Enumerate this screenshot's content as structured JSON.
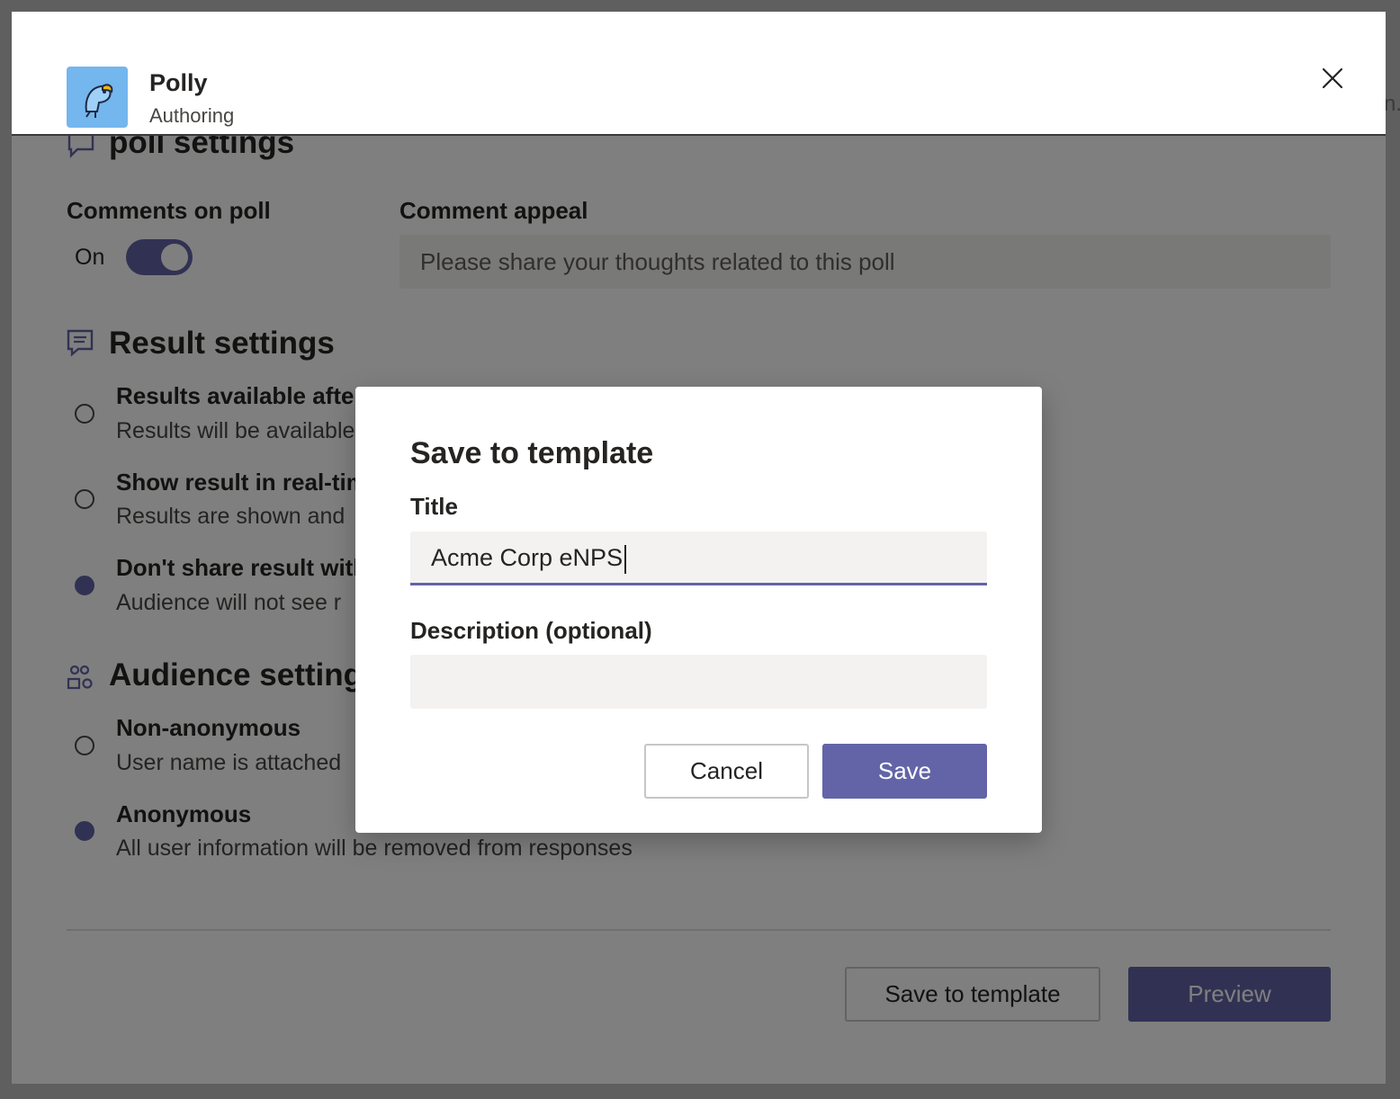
{
  "header": {
    "app_name": "Polly",
    "subtitle": "Authoring",
    "logo_icon": "parrot-icon",
    "close_icon": "close-icon"
  },
  "background_edge": {
    "right_fragment": "n."
  },
  "poll_settings": {
    "heading": "poll settings",
    "comments_label": "Comments on poll",
    "comments_toggle_state": "On",
    "comments_enabled": true,
    "appeal_label": "Comment appeal",
    "appeal_placeholder": "Please share your thoughts related to this poll"
  },
  "result_settings": {
    "heading": "Result settings",
    "options": [
      {
        "title": "Results available after poll closes",
        "desc": "Results will be available",
        "selected": false
      },
      {
        "title": "Show result in real-time",
        "desc": "Results are shown and",
        "selected": false
      },
      {
        "title": "Don't share result with",
        "desc": "Audience will not see r",
        "selected": true
      }
    ]
  },
  "audience_settings": {
    "heading": "Audience settings",
    "options": [
      {
        "title": "Non-anonymous",
        "desc": "User name is attached",
        "selected": false
      },
      {
        "title": "Anonymous",
        "desc": "All user information will be removed from responses",
        "selected": true
      }
    ]
  },
  "footer": {
    "save_template_label": "Save to template",
    "preview_label": "Preview"
  },
  "modal": {
    "title": "Save to template",
    "title_label": "Title",
    "title_value": "Acme Corp eNPS",
    "description_label": "Description (optional)",
    "description_value": "",
    "cancel_label": "Cancel",
    "save_label": "Save"
  },
  "colors": {
    "accent": "#6264a7",
    "logo_bg": "#74b6ee",
    "input_bg": "#f3f2f1"
  }
}
